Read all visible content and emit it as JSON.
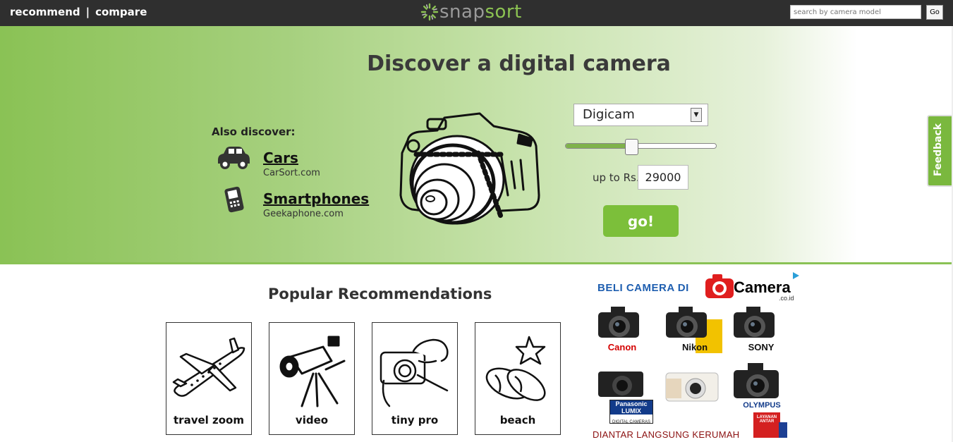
{
  "nav": {
    "recommend": "recommend",
    "separator": "|",
    "compare": "compare"
  },
  "logo": {
    "text_part1": "snap",
    "text_part2": "sort"
  },
  "search": {
    "placeholder": "search by camera model",
    "go_label": "Go"
  },
  "hero": {
    "title": "Discover a digital camera",
    "also_discover": "Also discover:",
    "items": [
      {
        "label": "Cars",
        "site": "CarSort.com"
      },
      {
        "label": "Smartphones",
        "site": "Geekaphone.com"
      }
    ],
    "camera_type": "Digicam",
    "price_slider_fraction": 0.44,
    "upto_label": "up to Rs.",
    "price_value": "29000",
    "go_label": "go!"
  },
  "feedback": {
    "label": "Feedback"
  },
  "popular": {
    "title": "Popular Recommendations",
    "cards": [
      {
        "label": "travel zoom"
      },
      {
        "label": "video"
      },
      {
        "label": "tiny pro"
      },
      {
        "label": "beach"
      }
    ]
  },
  "ad": {
    "headline": "BELI CAMERA DI",
    "brand": "Camera",
    "brand_sub": ".co.id",
    "choice_icon": "adchoices-triangle",
    "brands": [
      "Canon",
      "Nikon",
      "SONY",
      "Panasonic LUMIX",
      "OLYMPUS"
    ],
    "panasonic_sub": "DIGITAL CAMERAS",
    "footer": "DIANTAR LANGSUNG KERUMAH",
    "truck_text": "LAYANAN ANTAR",
    "colors": {
      "headline": "#1f5fb0",
      "canon": "#d40000",
      "nikon": "#f2c200",
      "footer": "#8b1010"
    }
  },
  "colors": {
    "accent": "#7cbf3a",
    "topbar": "#2f2f2f"
  }
}
